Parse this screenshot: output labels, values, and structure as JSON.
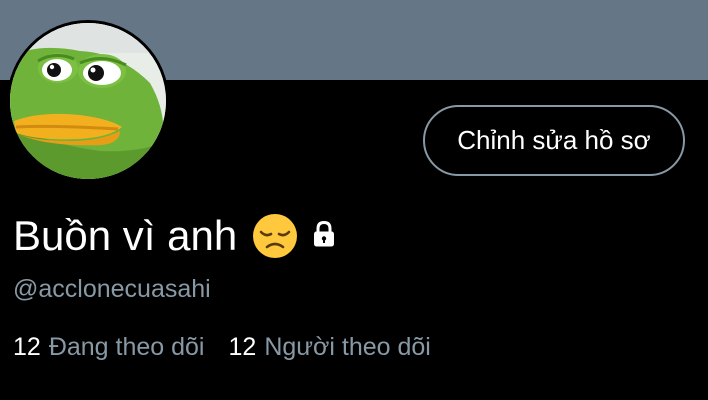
{
  "profile": {
    "banner_color": "#657786",
    "avatar": "pepe-frog-avatar",
    "display_name": "Buồn vì anh",
    "name_emoji": "disappointed-face-icon",
    "protected_icon": "lock-icon",
    "handle": "@acclonecuasahi",
    "edit_button_label": "Chỉnh sửa hồ sơ"
  },
  "stats": {
    "following_count": "12",
    "following_label": "Đang theo dõi",
    "followers_count": "12",
    "followers_label": "Người theo dõi"
  },
  "colors": {
    "background": "#000000",
    "primary_text": "#ffffff",
    "secondary_text": "#8899a6",
    "button_border": "#8899a6"
  }
}
